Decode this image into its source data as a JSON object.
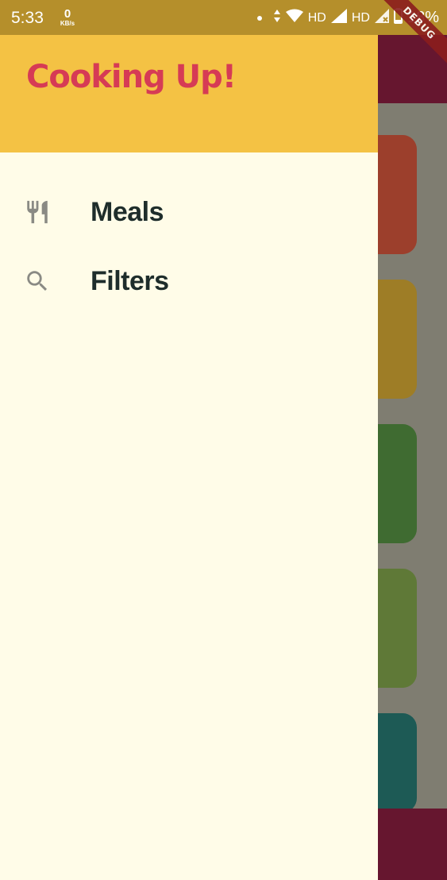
{
  "status_bar": {
    "time": "5:33",
    "net_speed_value": "0",
    "net_speed_unit": "KB/s",
    "network_label_1": "HD",
    "network_label_2": "HD",
    "battery": "18%"
  },
  "debug_banner": "DEBUG",
  "drawer": {
    "title": "Cooking Up!",
    "items": [
      {
        "label": "Meals",
        "icon": "restaurant-icon"
      },
      {
        "label": "Filters",
        "icon": "search-icon"
      }
    ]
  },
  "colors": {
    "drawer_header": "#f4c244",
    "drawer_background": "#fffce8",
    "title": "#d63b55",
    "app_bar": "#66162f",
    "item_text": "#1e2d2b",
    "item_icon": "#8a8a84"
  }
}
